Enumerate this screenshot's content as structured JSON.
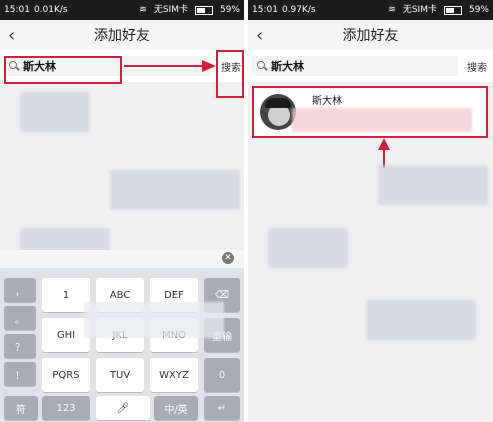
{
  "left": {
    "status": {
      "time": "15:01",
      "speed": "0.01K/s",
      "sim": "无SIM卡",
      "battery": "59%",
      "battery_level": 0.59
    },
    "nav": {
      "title": "添加好友"
    },
    "search": {
      "value": "斯大林",
      "button": "搜索"
    },
    "keyboard": {
      "row1": [
        "，",
        "1",
        "ABC",
        "DEF"
      ],
      "row2": [
        "。",
        "GHI",
        "JKL",
        "MNO",
        "重输"
      ],
      "row3": [
        "？",
        "PQRS",
        "TUV",
        "WXYZ",
        "0"
      ],
      "row4": [
        "！",
        "符",
        "123",
        "中/英"
      ],
      "bottom_right": "↵"
    }
  },
  "right": {
    "status": {
      "time": "15:01",
      "speed": "0.97K/s",
      "sim": "无SIM卡",
      "battery": "59%",
      "battery_level": 0.59
    },
    "nav": {
      "title": "添加好友"
    },
    "search": {
      "value": "斯大林",
      "button": "搜索"
    },
    "result": {
      "name": "斯大林"
    }
  }
}
